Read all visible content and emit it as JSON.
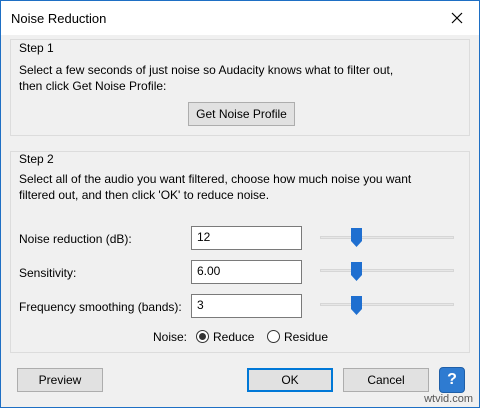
{
  "window": {
    "title": "Noise Reduction",
    "close_glyph": "✕"
  },
  "step1": {
    "title": "Step 1",
    "line1": "Select a few seconds of just noise so Audacity knows what to filter out,",
    "line2": "then click Get Noise Profile:",
    "button": "Get Noise Profile"
  },
  "step2": {
    "title": "Step 2",
    "line1": "Select all of the audio you want filtered, choose how much noise you want",
    "line2": "filtered out, and then click 'OK' to reduce noise.",
    "params": [
      {
        "label": "Noise reduction (dB):",
        "value": "12",
        "slider_fraction": 0.27
      },
      {
        "label": "Sensitivity:",
        "value": "6.00",
        "slider_fraction": 0.27
      },
      {
        "label": "Frequency smoothing (bands):",
        "value": "3",
        "slider_fraction": 0.27
      }
    ],
    "noise_label": "Noise:",
    "options": [
      {
        "label": "Reduce",
        "selected": true
      },
      {
        "label": "Residue",
        "selected": false
      }
    ]
  },
  "footer": {
    "preview": "Preview",
    "ok": "OK",
    "cancel": "Cancel",
    "help": "?",
    "watermark": "wtvid.com"
  },
  "colors": {
    "accent": "#0078d7",
    "help_blue": "#2e7bd1",
    "thumb": "#1f6fd0"
  }
}
